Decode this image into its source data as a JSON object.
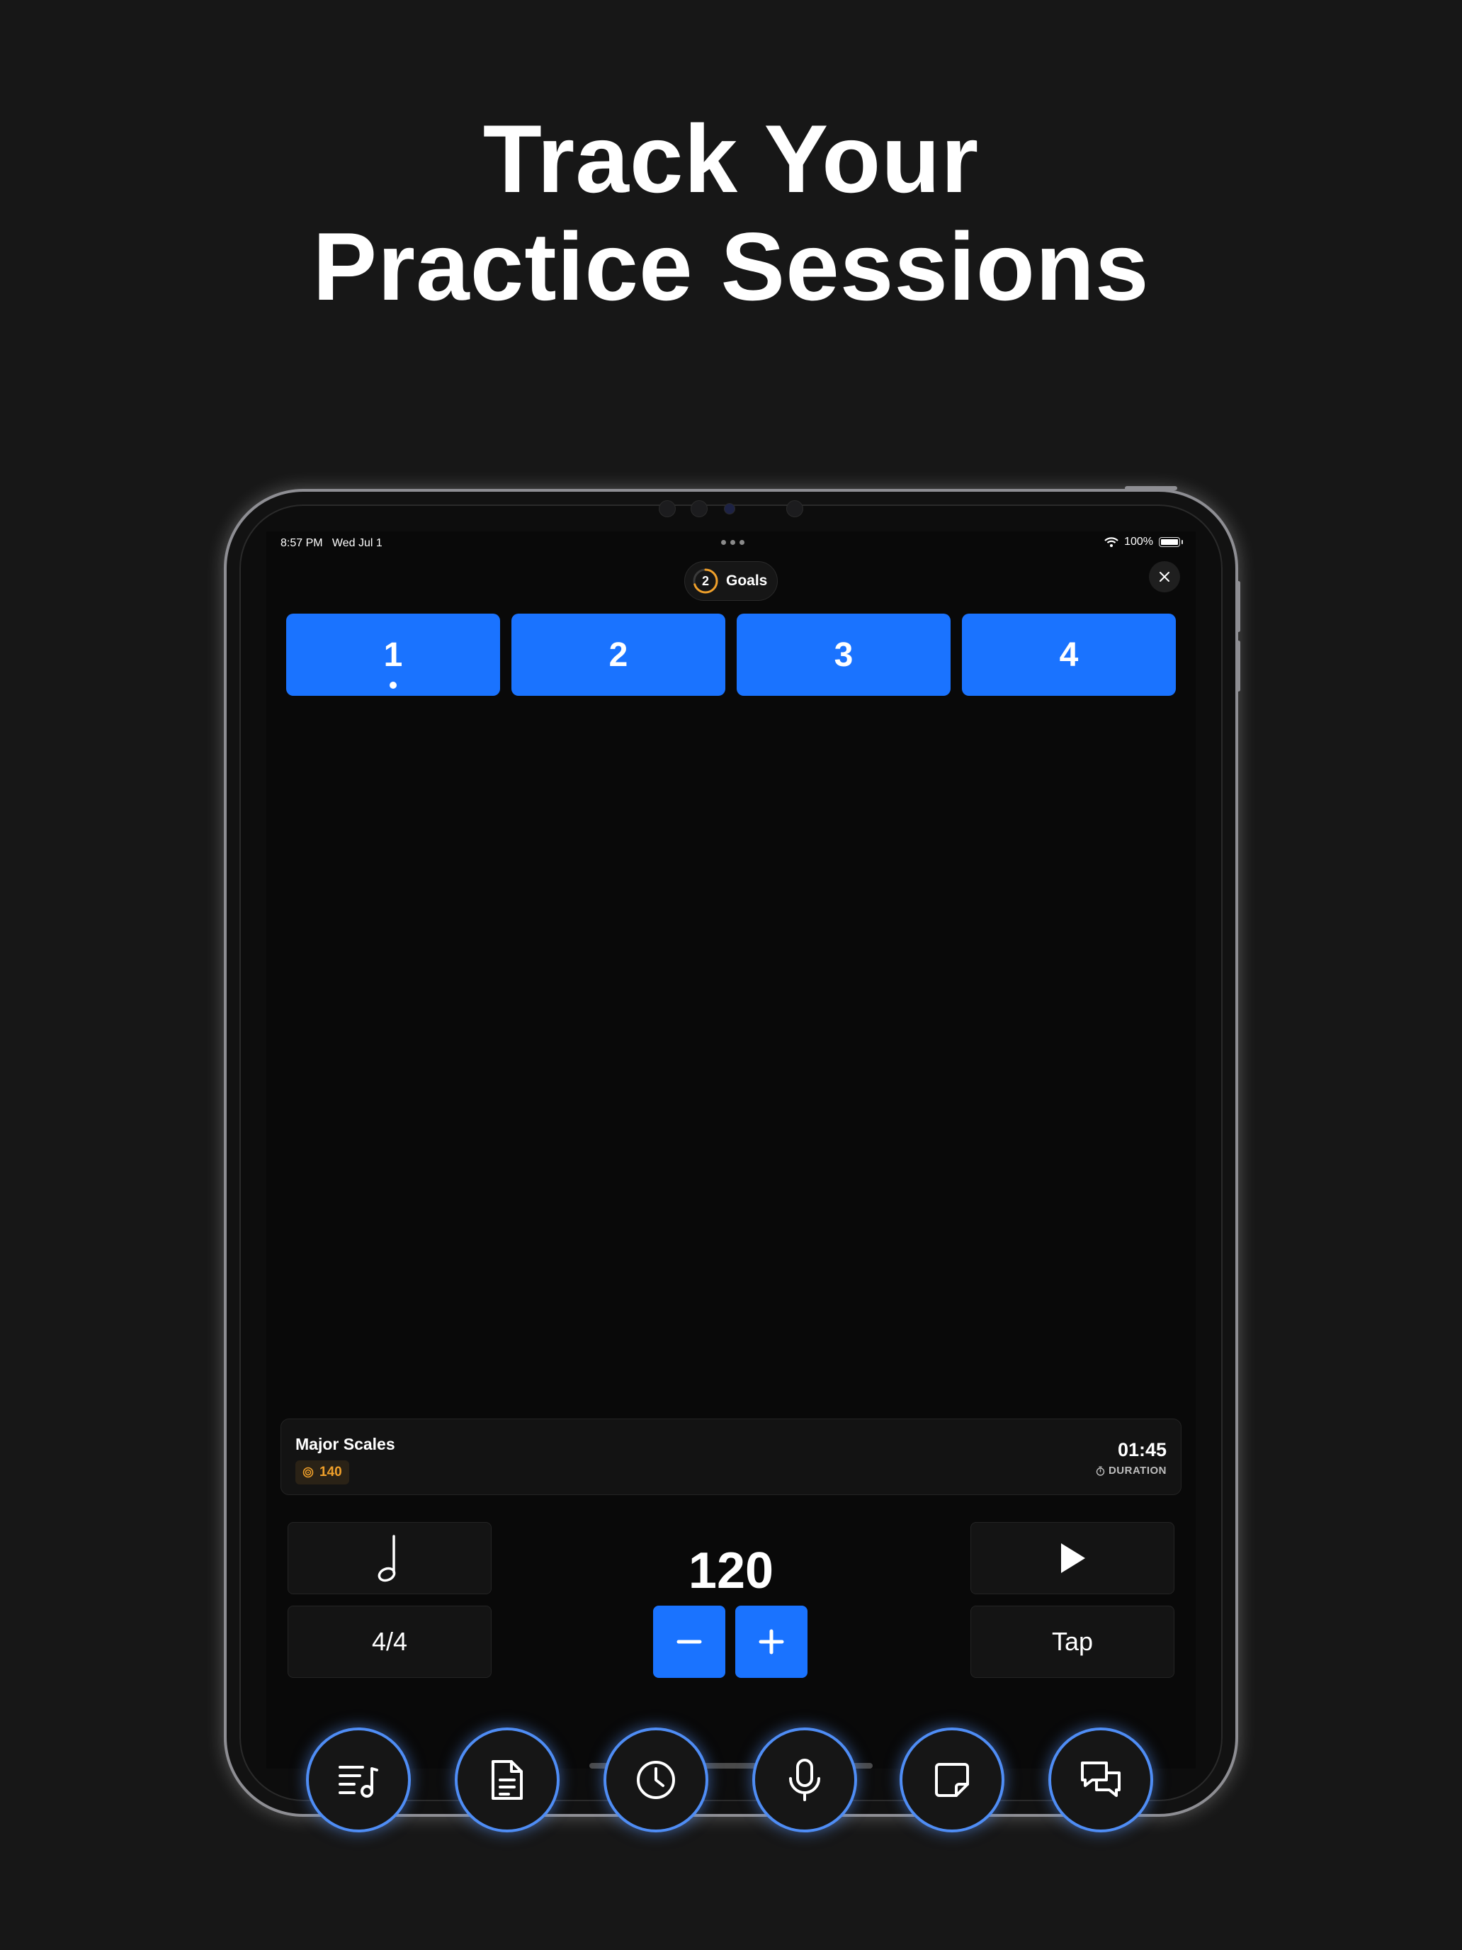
{
  "headline": {
    "line1": "Track Your",
    "line2": "Practice Sessions"
  },
  "status_bar": {
    "time": "8:57 PM   Wed Jul 1",
    "battery": "100%"
  },
  "goals": {
    "count": "2",
    "label": "Goals",
    "progress_fraction": 0.7,
    "accent": "#f0a02a"
  },
  "beats": [
    "1",
    "2",
    "3",
    "4"
  ],
  "active_beat": 1,
  "session": {
    "title": "Major Scales",
    "target_bpm": "140",
    "time": "01:45",
    "duration_label": "DURATION"
  },
  "metronome": {
    "bpm": "120",
    "time_signature": "4/4",
    "tap_label": "Tap",
    "note_value": "quarter-note"
  },
  "tabs": [
    {
      "icon": "playlist-music-icon"
    },
    {
      "icon": "document-icon"
    },
    {
      "icon": "clock-icon"
    },
    {
      "icon": "microphone-icon"
    },
    {
      "icon": "note-icon"
    },
    {
      "icon": "chat-bubbles-icon"
    }
  ],
  "colors": {
    "accent_blue": "#1a73ff",
    "background": "#171717",
    "tab_ring": "#4f8df5"
  }
}
